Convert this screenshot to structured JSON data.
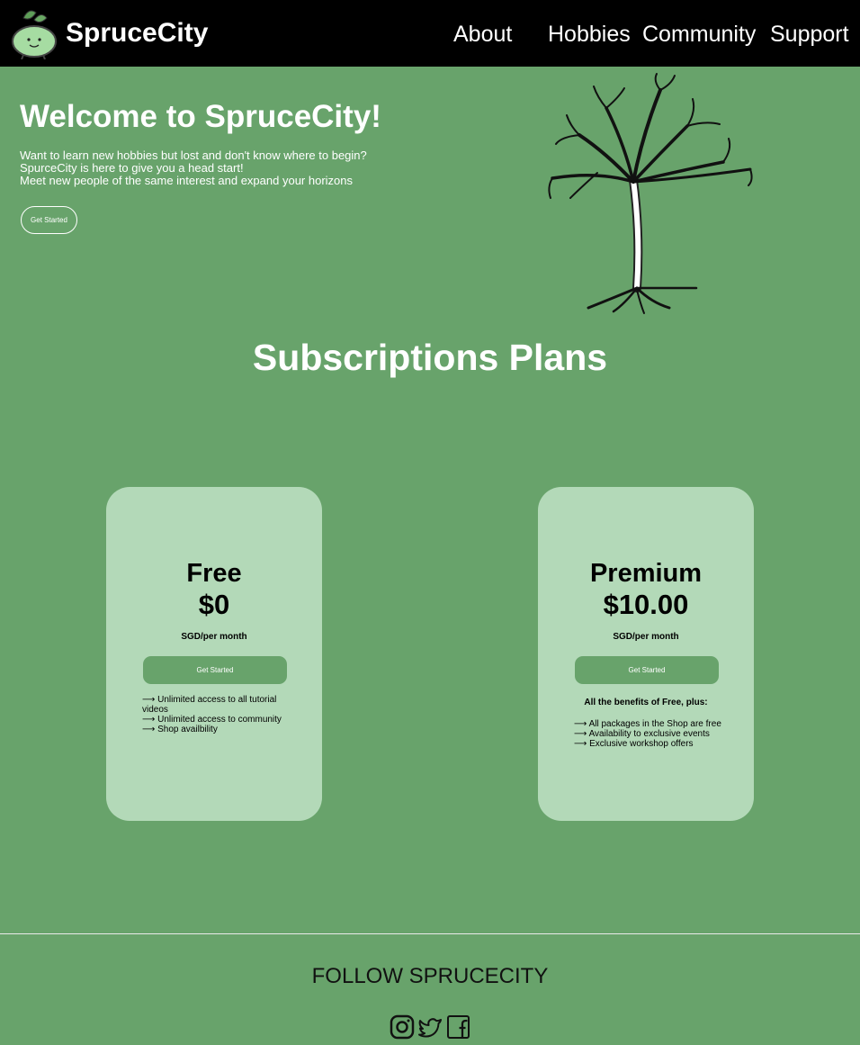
{
  "nav": {
    "brand": "SpruceCity",
    "links": [
      "About",
      "Hobbies",
      "Community",
      "Support"
    ]
  },
  "hero": {
    "title": "Welcome to SpruceCity!",
    "lines": [
      "Want to learn new hobbies but lost and don't know where to begin?",
      "SpurceCity is here to give you a head start!",
      "Meet new people of the same interest and expand your horizons"
    ],
    "cta": "Get Started"
  },
  "plans": {
    "title": "Subscriptions Plans",
    "cards": [
      {
        "name": "Free",
        "price": "$0",
        "period": "SGD/per month",
        "cta": "Get Started",
        "benefits_head": "",
        "features": [
          "⟶ Unlimited access to all tutorial videos",
          "⟶ Unlimited access to community",
          "⟶ Shop availbility"
        ]
      },
      {
        "name": "Premium",
        "price": "$10.00",
        "period": "SGD/per month",
        "cta": "Get Started",
        "benefits_head": "All the benefits of Free, plus:",
        "features": [
          "⟶ All packages in the Shop are free",
          "⟶ Availability to exclusive events",
          "⟶ Exclusive workshop offers"
        ]
      }
    ]
  },
  "footer": {
    "follow": "FOLLOW SPRUCECITY",
    "icons": [
      "instagram-icon",
      "twitter-icon",
      "facebook-icon"
    ]
  },
  "colors": {
    "background": "#68a36b",
    "nav": "#000000",
    "card": "#b3d9b8"
  }
}
